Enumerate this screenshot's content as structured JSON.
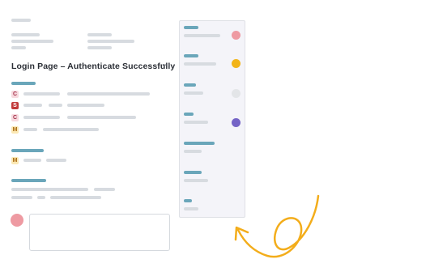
{
  "issue": {
    "title": "Login Page – Authenticate Successfully",
    "more_label": "···"
  },
  "badges": {
    "row1": "C",
    "row2": "S",
    "row3": "C",
    "row4": "M",
    "row5": "M"
  },
  "colors": {
    "accent_teal": "#6aa6ba",
    "placeholder_gray": "#d7dbe0",
    "panel_bg": "#f4f4f9",
    "status_red": "#ee9aa2",
    "status_amber": "#f2b418",
    "status_gray": "#e3e5e8",
    "status_purple": "#7463c6",
    "arrow_amber": "#f3ad1b"
  },
  "icons": {
    "more": "ellipsis-icon",
    "arrow": "curly-arrow-icon"
  }
}
